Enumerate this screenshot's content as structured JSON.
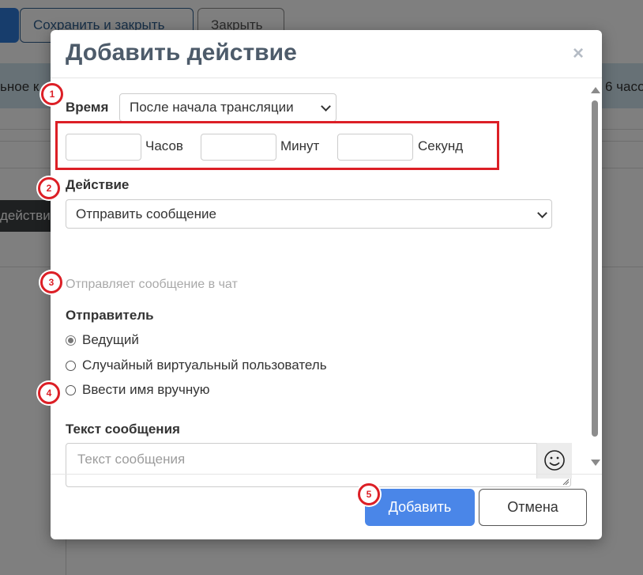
{
  "background": {
    "save_close_label": "Сохранить и закрыть",
    "close_label": "Закрыть",
    "band_left_text": "ьное к",
    "band_right_text": "6 часо",
    "dark_button_label": "действие"
  },
  "modal": {
    "title": "Добавить действие",
    "close_symbol": "×",
    "time": {
      "label": "Время",
      "selected": "После начала трансляции",
      "hours_label": "Часов",
      "minutes_label": "Минут",
      "seconds_label": "Секунд"
    },
    "action": {
      "label": "Действие",
      "selected": "Отправить сообщение",
      "hint": "Отправляет сообщение в чат"
    },
    "sender": {
      "label": "Отправитель",
      "options": [
        "Ведущий",
        "Случайный виртуальный пользователь",
        "Ввести имя вручную"
      ],
      "selected_index": 0
    },
    "message": {
      "label": "Текст сообщения",
      "placeholder": "Текст сообщения"
    },
    "footer": {
      "add_label": "Добавить",
      "cancel_label": "Отмена"
    }
  },
  "annotations": {
    "badges": [
      "1",
      "2",
      "3",
      "4",
      "5"
    ],
    "color": "#dc1f26"
  },
  "colors": {
    "primary": "#4a86e8",
    "title": "#4d5b6a",
    "highlight": "#dc1f26"
  }
}
